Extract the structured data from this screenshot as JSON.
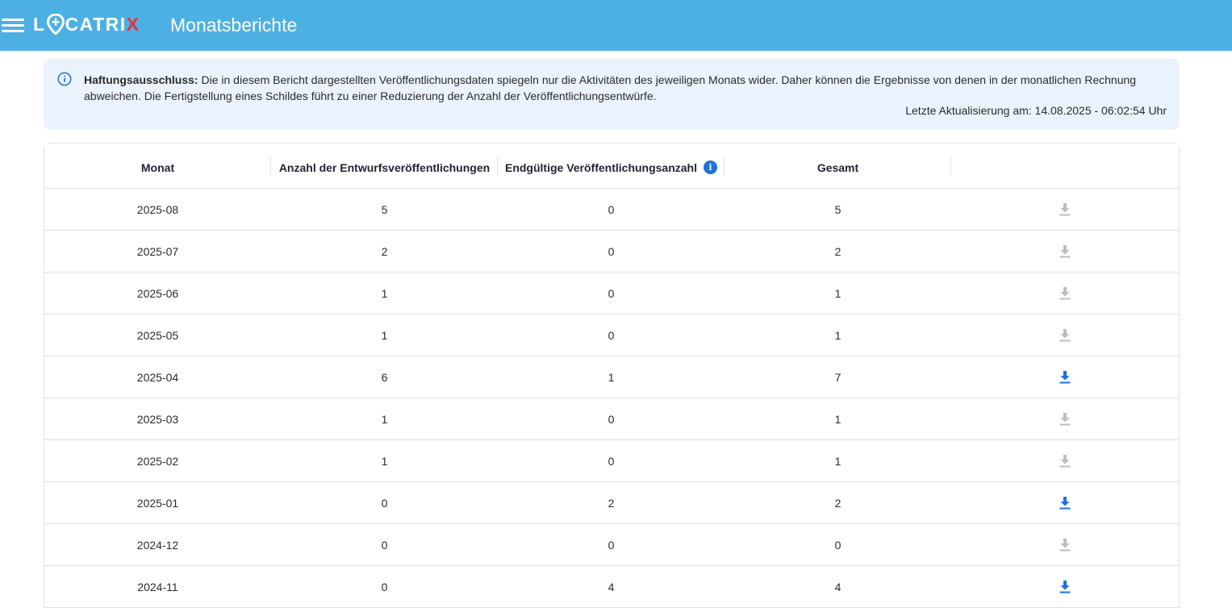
{
  "header": {
    "logo_text_a": "L",
    "logo_text_b": "CATRI",
    "logo_text_x": "X",
    "title": "Monatsberichte"
  },
  "notice": {
    "label": "Haftungsausschluss:",
    "text": " Die in diesem Bericht dargestellten Veröffentlichungsdaten spiegeln nur die Aktivitäten des jeweiligen Monats wider. Daher können die Ergebnisse von denen in der monatlichen Rechnung abweichen. Die Fertigstellung eines Schildes führt zu einer Reduzierung der Anzahl der Veröffentlichungsentwürfe.",
    "updated": "Letzte Aktualisierung am: 14.08.2025 - 06:02:54 Uhr"
  },
  "table": {
    "columns": [
      "Monat",
      "Anzahl der Entwurfsveröffentlichungen",
      "Endgültige Veröffentlichungsanzahl",
      "Gesamt",
      ""
    ],
    "rows": [
      {
        "month": "2025-08",
        "drafts": "5",
        "final": "0",
        "total": "5",
        "download_enabled": false
      },
      {
        "month": "2025-07",
        "drafts": "2",
        "final": "0",
        "total": "2",
        "download_enabled": false
      },
      {
        "month": "2025-06",
        "drafts": "1",
        "final": "0",
        "total": "1",
        "download_enabled": false
      },
      {
        "month": "2025-05",
        "drafts": "1",
        "final": "0",
        "total": "1",
        "download_enabled": false
      },
      {
        "month": "2025-04",
        "drafts": "6",
        "final": "1",
        "total": "7",
        "download_enabled": true
      },
      {
        "month": "2025-03",
        "drafts": "1",
        "final": "0",
        "total": "1",
        "download_enabled": false
      },
      {
        "month": "2025-02",
        "drafts": "1",
        "final": "0",
        "total": "1",
        "download_enabled": false
      },
      {
        "month": "2025-01",
        "drafts": "0",
        "final": "2",
        "total": "2",
        "download_enabled": true
      },
      {
        "month": "2024-12",
        "drafts": "0",
        "final": "0",
        "total": "0",
        "download_enabled": false
      },
      {
        "month": "2024-11",
        "drafts": "0",
        "final": "4",
        "total": "4",
        "download_enabled": true
      }
    ]
  },
  "colors": {
    "header_bg": "#4db0e3",
    "notice_bg": "#eaf3fd",
    "accent_blue": "#1f6fe0",
    "download_disabled": "#bdbdbd",
    "logo_x": "#e8313c"
  },
  "icons": {
    "menu": "hamburger-menu-icon",
    "info": "info-circle-icon",
    "download": "download-icon"
  }
}
